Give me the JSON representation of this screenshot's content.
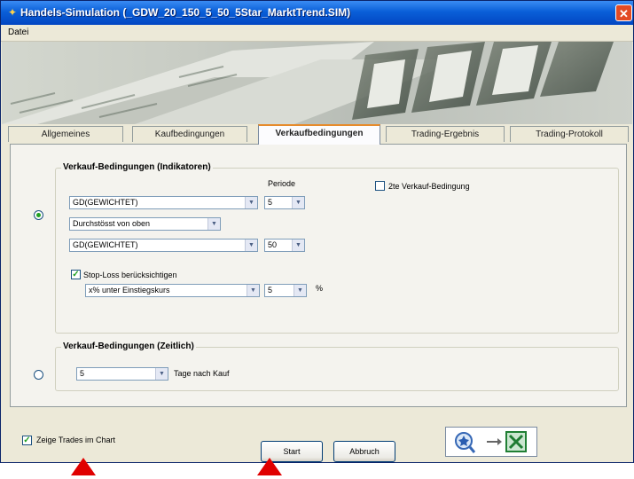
{
  "window": {
    "title": "Handels-Simulation (_GDW_20_150_5_50_5Star_MarktTrend.SIM)"
  },
  "menu": {
    "items": [
      "Datei"
    ]
  },
  "tabs": [
    "Allgemeines",
    "Kaufbedingungen",
    "Verkaufbedingungen",
    "Trading-Ergebnis",
    "Trading-Protokoll"
  ],
  "active_tab": "Verkaufbedingungen",
  "indicator_group": {
    "title": "Verkauf-Bedingungen (Indikatoren)",
    "period_label": "Periode",
    "indicator1": "GD(GEWICHTET)",
    "period1": "5",
    "cross_mode": "Durchstösst von oben",
    "indicator2": "GD(GEWICHTET)",
    "period2": "50",
    "second_condition_label": "2te Verkauf-Bedingung",
    "second_condition_checked": false,
    "stoploss_label": "Stop-Loss berücksichtigen",
    "stoploss_checked": true,
    "stoploss_mode": "x% unter Einstiegskurs",
    "stoploss_value": "5",
    "percent_sign": "%",
    "selected": true
  },
  "time_group": {
    "title": "Verkauf-Bedingungen (Zeitlich)",
    "days": "5",
    "days_label": "Tage nach Kauf",
    "selected": false
  },
  "footer": {
    "show_trades_label": "Zeige Trades im Chart",
    "show_trades_checked": true,
    "start_label": "Start",
    "cancel_label": "Abbruch"
  },
  "colors": {
    "titlebar": "#0a5fd8",
    "annotation_arrow": "#e00000",
    "active_tab_accent": "#e68b2c"
  }
}
